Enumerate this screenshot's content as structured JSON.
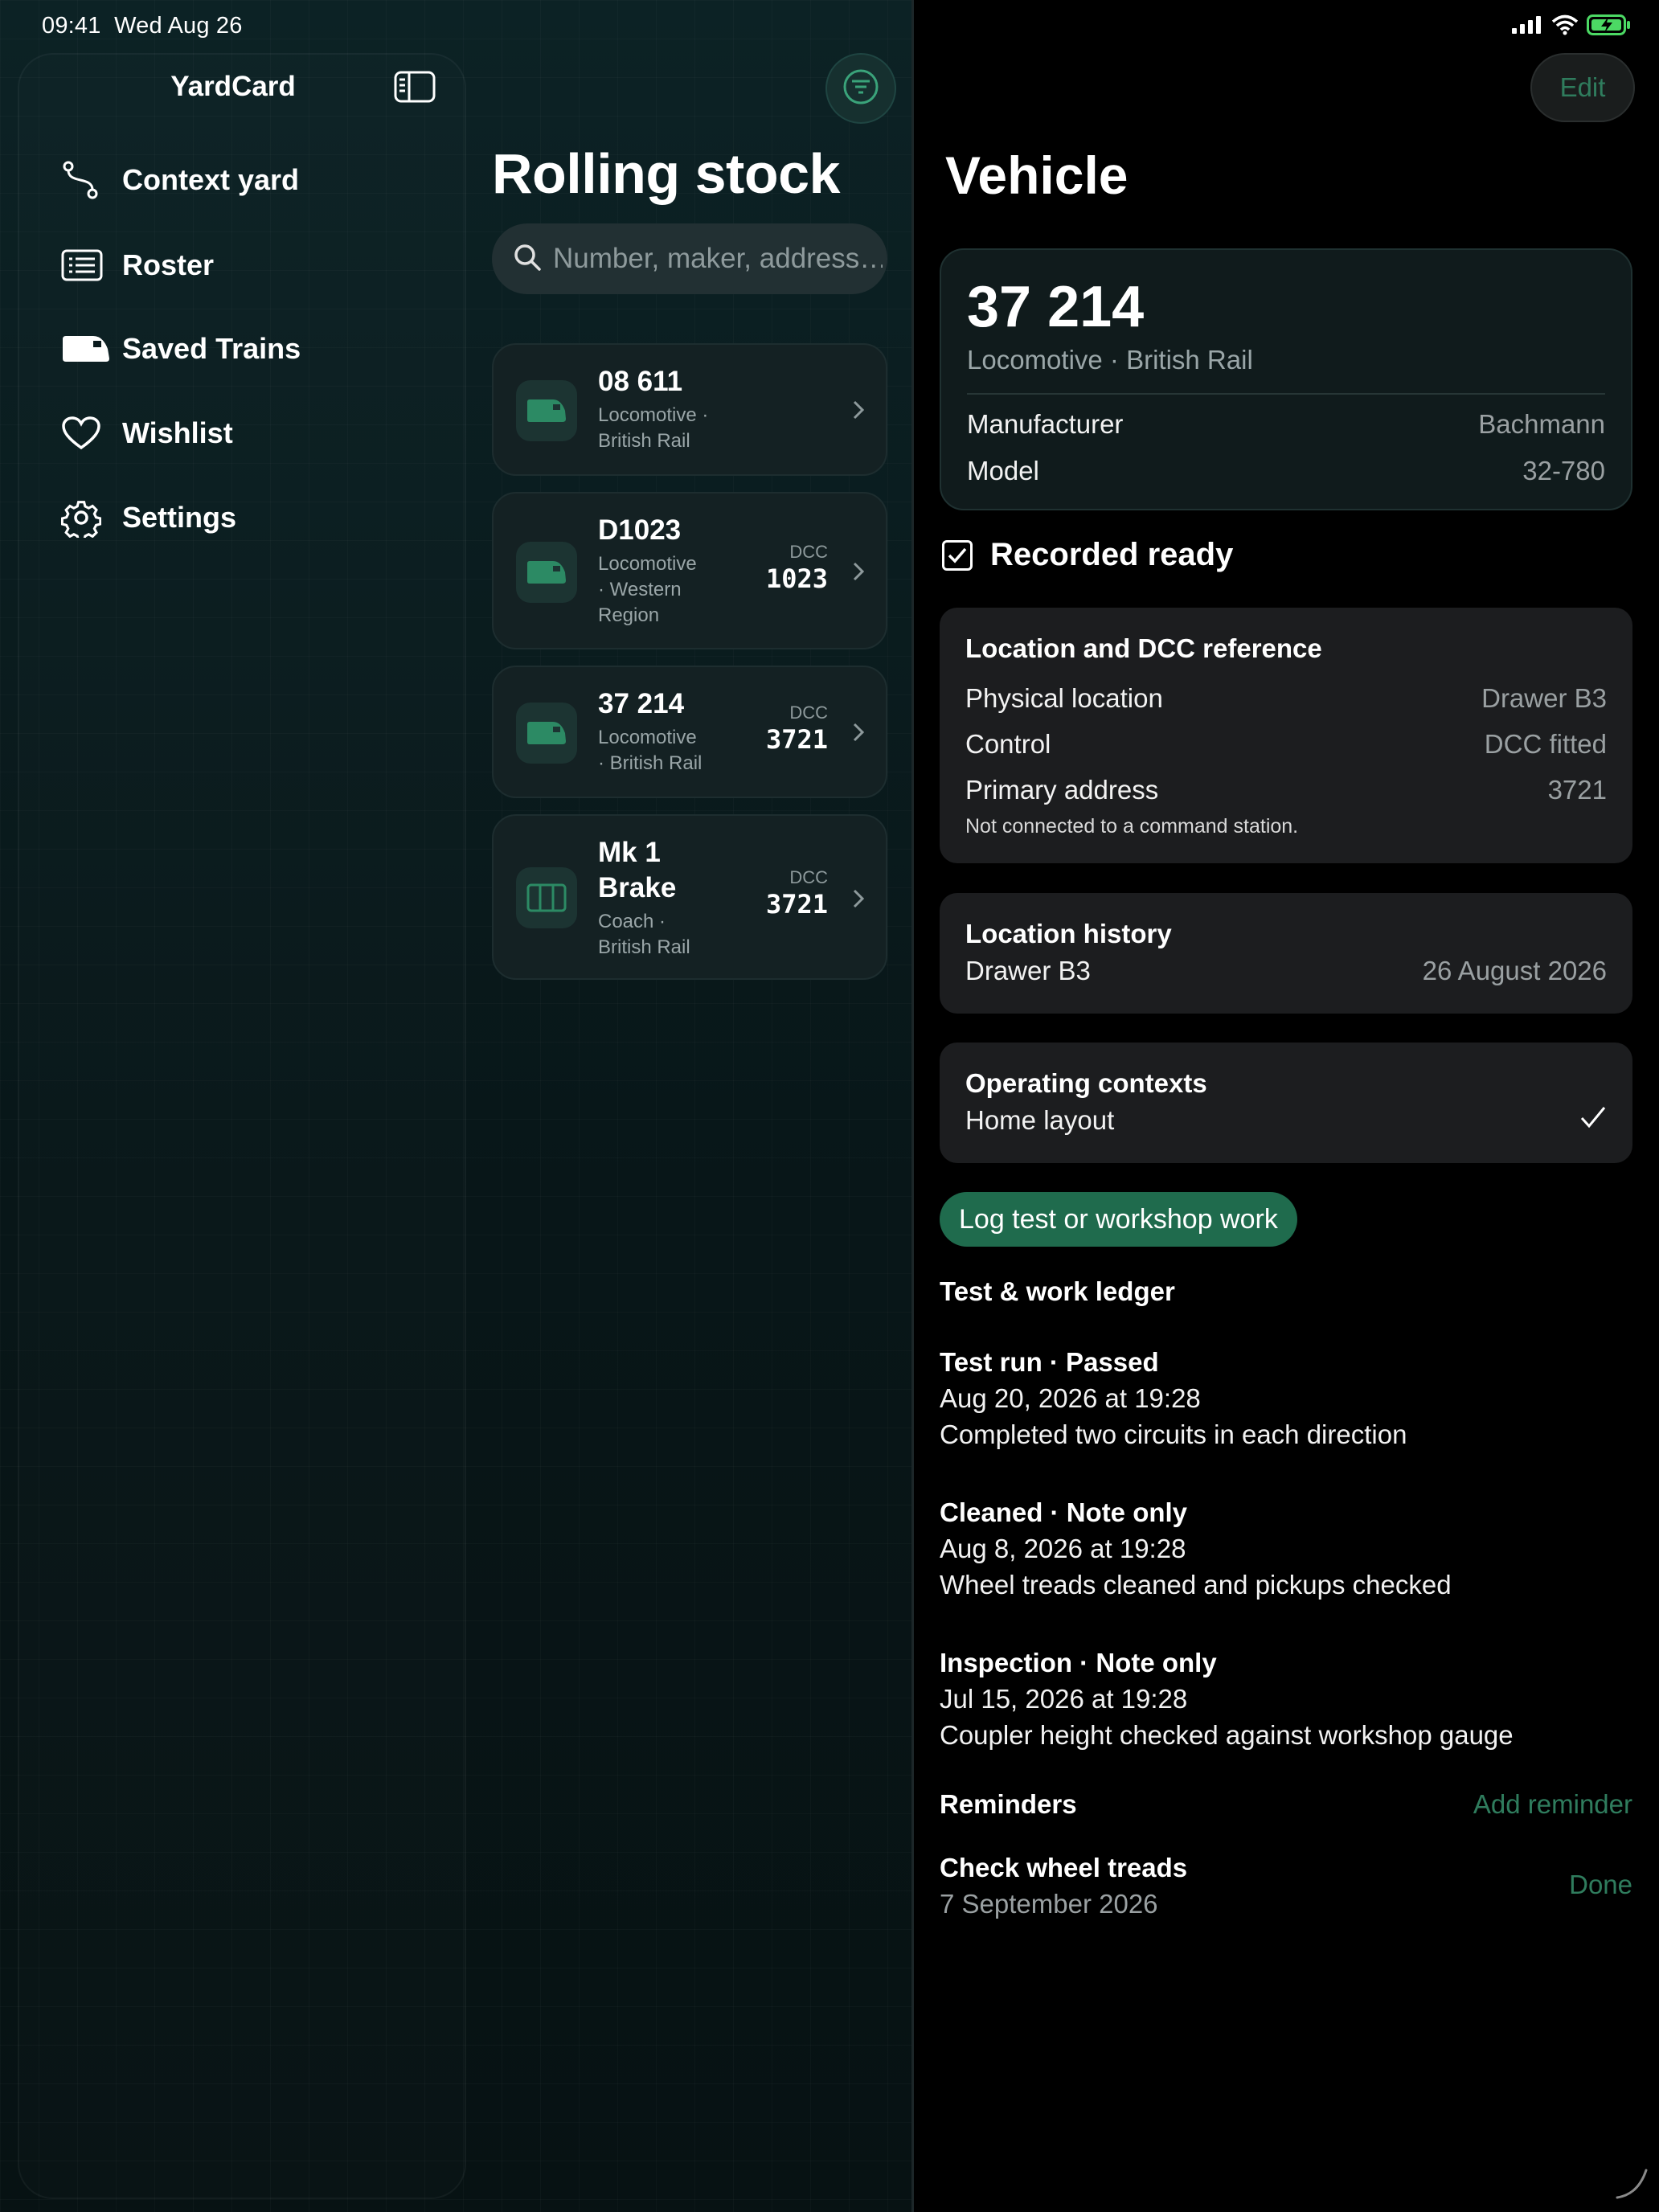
{
  "status_bar": {
    "time": "09:41",
    "date": "Wed Aug 26"
  },
  "sidebar": {
    "title": "YardCard",
    "items": [
      {
        "label": "Context yard",
        "icon": "route-icon"
      },
      {
        "label": "Roster",
        "icon": "list-icon"
      },
      {
        "label": "Saved Trains",
        "icon": "train-icon"
      },
      {
        "label": "Wishlist",
        "icon": "heart-icon"
      },
      {
        "label": "Settings",
        "icon": "gear-icon"
      }
    ]
  },
  "list": {
    "title": "Rolling stock",
    "search_placeholder": "Number, maker, address…",
    "items": [
      {
        "name": "08 611",
        "sub_lines": [
          "Locomotive ·",
          "British Rail"
        ],
        "dcc_label": "",
        "dcc_value": "",
        "icon": "locomotive-icon"
      },
      {
        "name": "D1023",
        "sub_lines": [
          "Locomotive",
          "· Western",
          "Region"
        ],
        "dcc_label": "DCC",
        "dcc_value": "1023",
        "icon": "locomotive-icon"
      },
      {
        "name": "37 214",
        "sub_lines": [
          "Locomotive",
          "· British Rail"
        ],
        "dcc_label": "DCC",
        "dcc_value": "3721",
        "icon": "locomotive-icon"
      },
      {
        "name_lines": [
          "Mk 1",
          "Brake"
        ],
        "sub_lines": [
          "Coach ·",
          "British Rail"
        ],
        "dcc_label": "DCC",
        "dcc_value": "3721",
        "icon": "coach-icon"
      }
    ]
  },
  "detail": {
    "edit_label": "Edit",
    "title": "Vehicle",
    "vehicle": {
      "number": "37 214",
      "subtitle": "Locomotive · British Rail",
      "manufacturer_key": "Manufacturer",
      "manufacturer": "Bachmann",
      "model_key": "Model",
      "model": "32-780"
    },
    "recorded_ready_label": "Recorded ready",
    "location": {
      "title": "Location and DCC reference",
      "physical_key": "Physical location",
      "physical": "Drawer B3",
      "control_key": "Control",
      "control": "DCC fitted",
      "address_key": "Primary address",
      "address": "3721",
      "note": "Not connected to a command station."
    },
    "history": {
      "title": "Location history",
      "place": "Drawer B3",
      "date": "26 August 2026"
    },
    "contexts": {
      "title": "Operating contexts",
      "item": "Home layout"
    },
    "log_button": "Log test or workshop work",
    "ledger_title": "Test & work ledger",
    "ledger": [
      {
        "title": "Test run · Passed",
        "date": "Aug 20, 2026 at 19:28",
        "note": "Completed two circuits in each direction"
      },
      {
        "title": "Cleaned · Note only",
        "date": "Aug 8, 2026 at 19:28",
        "note": "Wheel treads cleaned and pickups checked"
      },
      {
        "title": "Inspection · Note only",
        "date": "Jul 15, 2026 at 19:28",
        "note": "Coupler height checked against workshop gauge"
      }
    ],
    "reminders_title": "Reminders",
    "add_reminder": "Add reminder",
    "reminder": {
      "title": "Check wheel treads",
      "date": "7 September 2026",
      "done_label": "Done"
    }
  },
  "colors": {
    "accent": "#2f7c5d",
    "button": "#1f6b4d",
    "sidebar_bg": "#0b1d20",
    "card_bg": "#142123"
  }
}
